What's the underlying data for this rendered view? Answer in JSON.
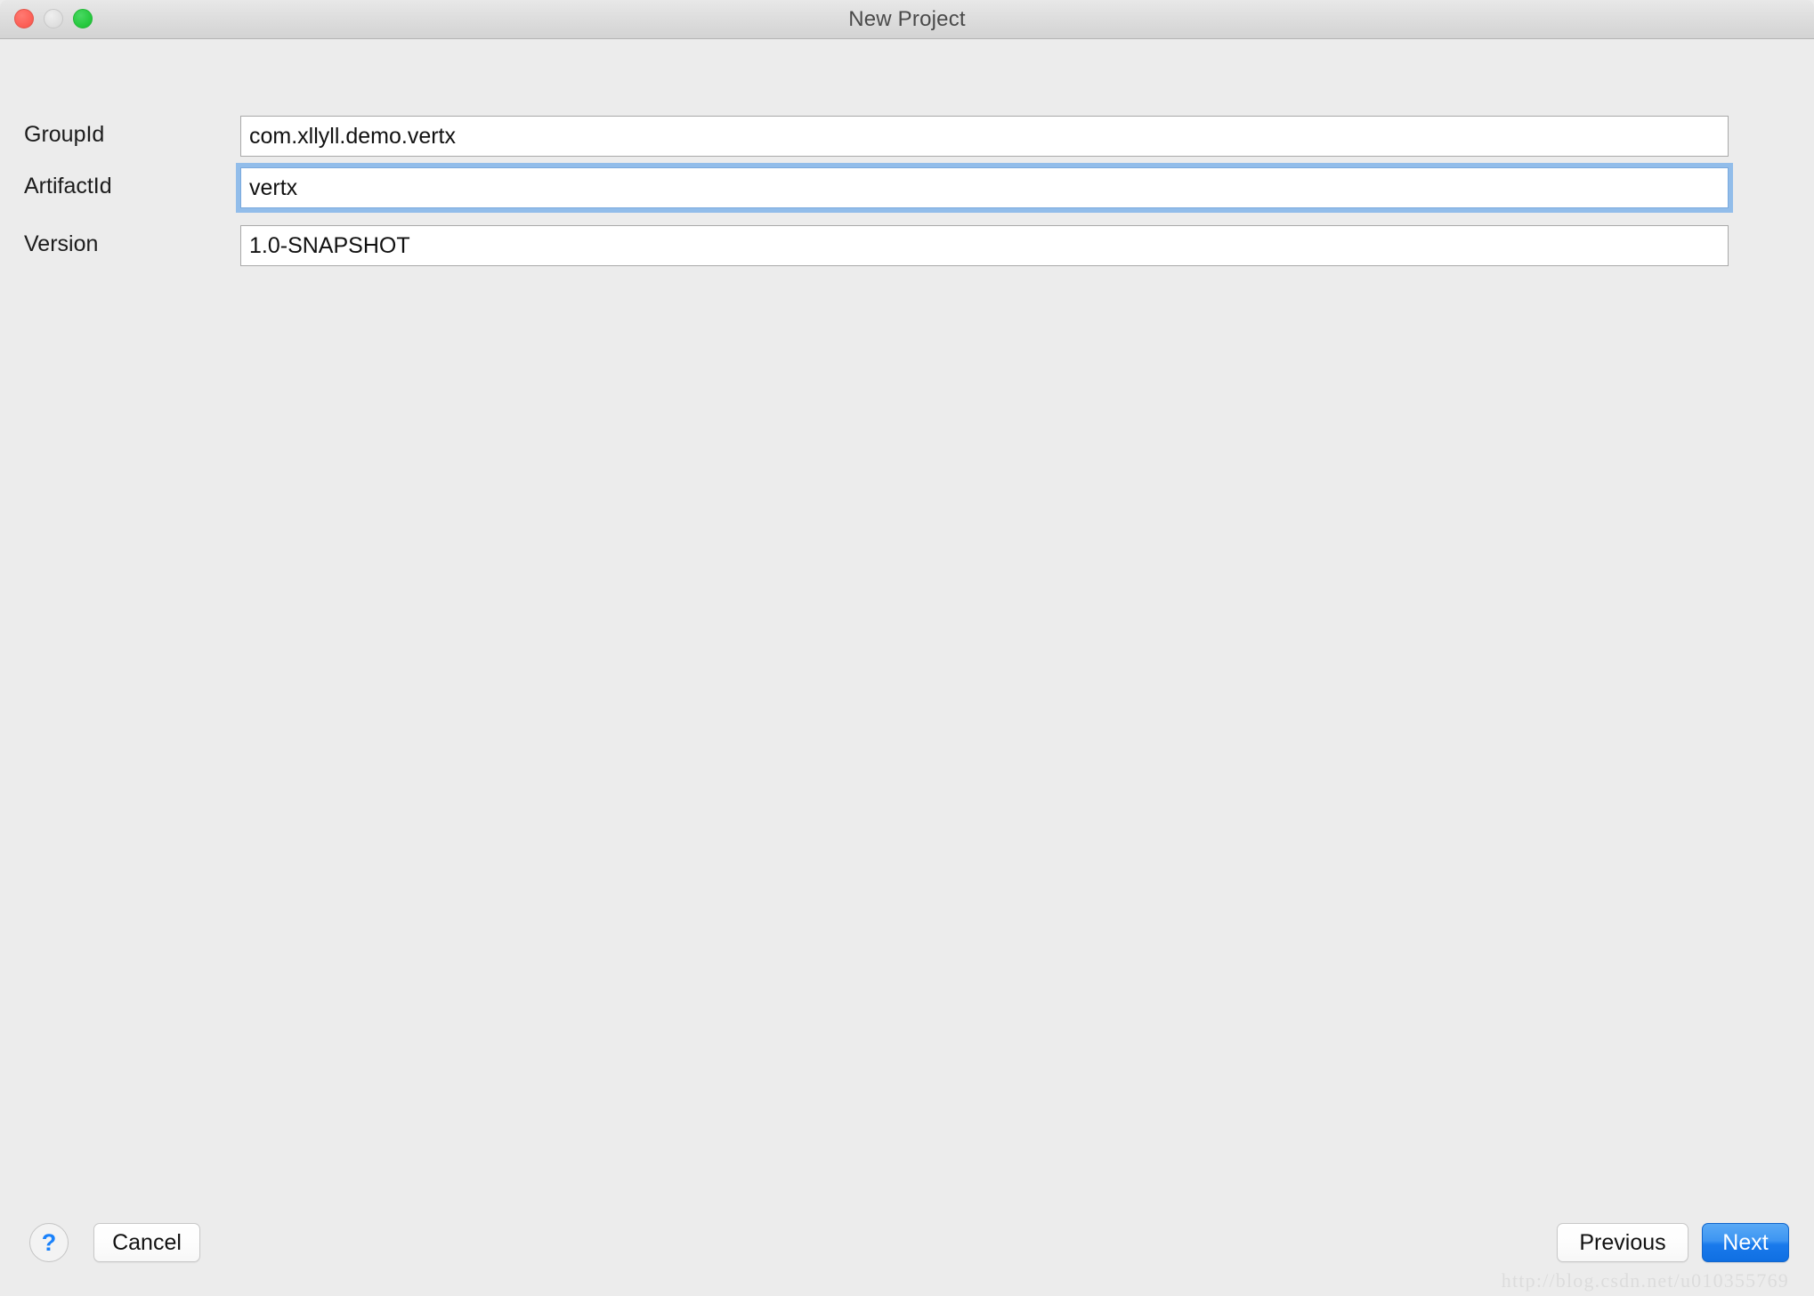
{
  "window": {
    "title": "New Project",
    "traffic_lights": [
      {
        "name": "close",
        "color": "#fc6057"
      },
      {
        "name": "minimize",
        "color": "#e0e0e0"
      },
      {
        "name": "maximize",
        "color": "#27c93f"
      }
    ]
  },
  "form": {
    "fields": [
      {
        "label": "GroupId",
        "value": "com.xllyll.demo.vertx",
        "placeholder": "",
        "focused": false
      },
      {
        "label": "ArtifactId",
        "value": "vertx",
        "placeholder": "",
        "focused": true
      },
      {
        "label": "Version",
        "value": "1.0-SNAPSHOT",
        "placeholder": "",
        "focused": false
      }
    ]
  },
  "footer": {
    "help_label": "?",
    "cancel_label": "Cancel",
    "previous_label": "Previous",
    "next_label": "Next",
    "next_accent_color": "#1a7aec"
  },
  "watermark": {
    "text": "http://blog.csdn.net/u010355769"
  }
}
